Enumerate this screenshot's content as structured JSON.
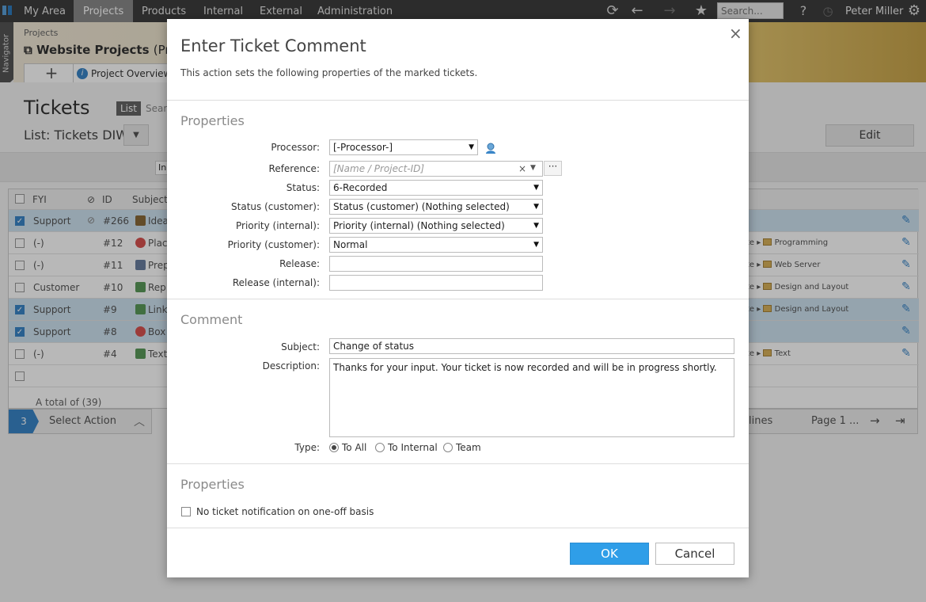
{
  "topnav": {
    "tabs": [
      "My Area",
      "Projects",
      "Products",
      "Internal",
      "External",
      "Administration"
    ],
    "active_tab": "Projects",
    "search_placeholder": "Search...",
    "help": "?",
    "user": "Peter Miller"
  },
  "navigator": {
    "label": "Navigator"
  },
  "header": {
    "breadcrumb": "Projects",
    "project_title": "Website Projects",
    "project_title_suffix": "(Proje",
    "add_tab": "+",
    "overview_tab": "Project Overview"
  },
  "page": {
    "title": "Tickets",
    "view_list": "List",
    "view_search": "Searc",
    "list_name": "List: Tickets DIW",
    "edit_button": "Edit",
    "filter_input": "In"
  },
  "grid": {
    "columns": [
      "FYI",
      "ID",
      "Subject"
    ],
    "rows": [
      {
        "selected": true,
        "fyi": "Support",
        "attach": true,
        "id": "#266",
        "subject": "Idea",
        "path": ""
      },
      {
        "selected": false,
        "fyi": "(-)",
        "attach": false,
        "id": "#12",
        "subject": "Plac",
        "path": "Programming"
      },
      {
        "selected": false,
        "fyi": "(-)",
        "attach": false,
        "id": "#11",
        "subject": "Prep",
        "path": "Web Server"
      },
      {
        "selected": false,
        "fyi": "Customer",
        "attach": false,
        "id": "#10",
        "subject": "Rep",
        "path": "Design and Layout"
      },
      {
        "selected": true,
        "fyi": "Support",
        "attach": false,
        "id": "#9",
        "subject": "Link",
        "path": "Design and Layout"
      },
      {
        "selected": true,
        "fyi": "Support",
        "attach": false,
        "id": "#8",
        "subject": "Box",
        "path": ""
      },
      {
        "selected": false,
        "fyi": "(-)",
        "attach": false,
        "id": "#4",
        "subject": "Text",
        "path": "Text"
      }
    ],
    "path_prefix": "te",
    "total": "A total of (39)"
  },
  "actionbar": {
    "count": "3",
    "label": "Select Action"
  },
  "pager": {
    "lines": "lines",
    "page": "Page 1 ..."
  },
  "dialog": {
    "title": "Enter Ticket Comment",
    "description": "This action sets the following properties of the marked tickets.",
    "section_properties": "Properties",
    "fields": [
      {
        "label": "Processor:",
        "value": "[-Processor-]"
      },
      {
        "label": "Reference:",
        "value": "[Name / Project-ID]"
      },
      {
        "label": "Status:",
        "value": "6-Recorded"
      },
      {
        "label": "Status (customer):",
        "value": "Status (customer) (Nothing selected)"
      },
      {
        "label": "Priority (internal):",
        "value": "Priority (internal) (Nothing selected)"
      },
      {
        "label": "Priority (customer):",
        "value": "Normal"
      },
      {
        "label": "Release:",
        "value": ""
      },
      {
        "label": "Release (internal):",
        "value": ""
      }
    ],
    "more_button": "···",
    "section_comment": "Comment",
    "subject_label": "Subject:",
    "subject_value": "Change of status",
    "description_label": "Description:",
    "description_value": "Thanks for your input. Your ticket is now recorded and will be in progress shortly.",
    "type_label": "Type:",
    "type_options": [
      "To All",
      "To Internal",
      "Team"
    ],
    "type_selected": "To All",
    "section_properties2": "Properties",
    "notification_label": "No ticket notification on one-off basis",
    "ok": "OK",
    "cancel": "Cancel",
    "close": "×"
  }
}
